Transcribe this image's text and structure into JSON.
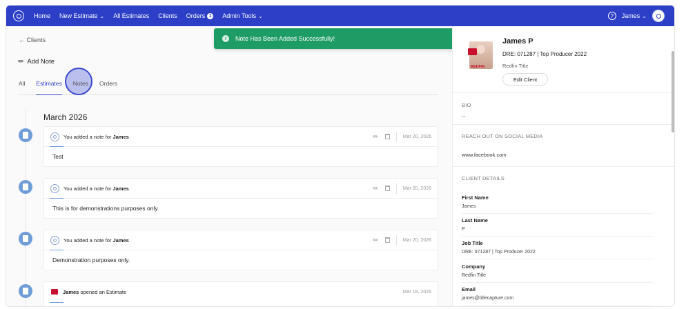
{
  "nav": {
    "items": [
      {
        "label": "Home",
        "has_chevron": false
      },
      {
        "label": "New Estimate",
        "has_chevron": true
      },
      {
        "label": "All Estimates",
        "has_chevron": false
      },
      {
        "label": "Clients",
        "has_chevron": false
      },
      {
        "label": "Orders",
        "has_chevron": false,
        "badge": "1"
      },
      {
        "label": "Admin Tools",
        "has_chevron": true
      }
    ],
    "help": "?",
    "user": "James"
  },
  "toast": {
    "message": "Note Has Been Added Successfully!",
    "icon": "i"
  },
  "left": {
    "back_label": "Clients",
    "add_note_label": "Add Note",
    "tabs": [
      "All",
      "Estimates",
      "Notes",
      "Orders"
    ],
    "month": "March 2026",
    "notes": [
      {
        "prefix": "You added a note for",
        "name": "James",
        "date": "Mar 20, 2026",
        "body": "Test"
      },
      {
        "prefix": "You added a note for",
        "name": "James",
        "date": "Mar 20, 2026",
        "body": "This is for demonstrations purposes only."
      },
      {
        "prefix": "You added a note for",
        "name": "James",
        "date": "Mar 20, 2026",
        "body": "Demonstration purposes only."
      }
    ],
    "estimate_event": {
      "name": "James",
      "text": "opened an Estimate",
      "date": "Mar 18, 2026"
    }
  },
  "right": {
    "name": "James P",
    "title": "DRE: 071287 | Top Producer 2022",
    "company": "Redfin Title",
    "redfin_logo_text": "REDFIN",
    "edit_label": "Edit Client",
    "bio_label": "BIO",
    "bio_value": "--",
    "social_label": "REACH OUT ON SOCIAL MEDIA",
    "social_value": "www.facebook.com",
    "details_label": "CLIENT DETAILS",
    "fields": [
      {
        "label": "First Name",
        "value": "James"
      },
      {
        "label": "Last Name",
        "value": "P"
      },
      {
        "label": "Job Title",
        "value": "DRE: 071287 | Top Producer 2022"
      },
      {
        "label": "Company",
        "value": "Redfin Title"
      },
      {
        "label": "Email",
        "value": "james@titlecapture.com"
      }
    ]
  },
  "colors": {
    "nav": "#2c3fc6",
    "toast": "#1e9c66",
    "timeline_dot": "#6e9dd8"
  }
}
